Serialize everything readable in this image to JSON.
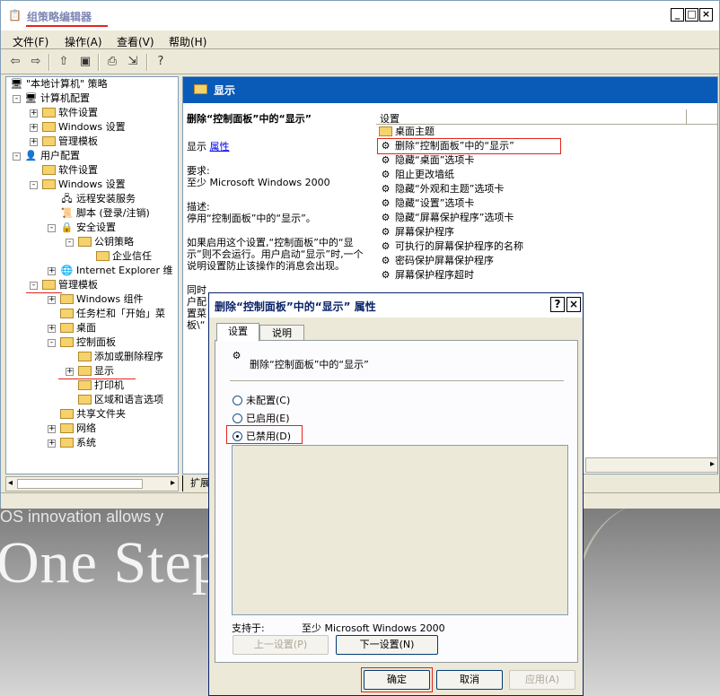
{
  "window": {
    "title": "组策略编辑器",
    "minimize": "_",
    "maximize": "□",
    "close": "×"
  },
  "menu": [
    "文件(F)",
    "操作(A)",
    "查看(V)",
    "帮助(H)"
  ],
  "toolbar": {
    "back": "⇦",
    "forward": "⇨",
    "up": "⇧",
    "show": "▣",
    "props": "⎙",
    "export": "⇲",
    "help": "?"
  },
  "tree": [
    {
      "label": "\"本地计算机\" 策略"
    },
    {
      "label": "计算机配置",
      "exp": "-"
    },
    {
      "label": "软件设置",
      "exp": "+"
    },
    {
      "label": "Windows 设置",
      "exp": "+"
    },
    {
      "label": "管理模板",
      "exp": "+"
    },
    {
      "label": "用户配置",
      "exp": "-"
    },
    {
      "label": "软件设置"
    },
    {
      "label": "Windows 设置",
      "exp": "-"
    },
    {
      "label": "远程安装服务"
    },
    {
      "label": "脚本 (登录/注销)"
    },
    {
      "label": "安全设置",
      "exp": "-"
    },
    {
      "label": "公钥策略",
      "exp": "-"
    },
    {
      "label": "企业信任"
    },
    {
      "label": "Internet Explorer 维",
      "exp": "+"
    },
    {
      "label": "管理模板",
      "exp": "-"
    },
    {
      "label": "Windows 组件",
      "exp": "+"
    },
    {
      "label": "任务栏和「开始」菜",
      "exp": ""
    },
    {
      "label": "桌面",
      "exp": "+"
    },
    {
      "label": "控制面板",
      "exp": "-"
    },
    {
      "label": "添加或删除程序"
    },
    {
      "label": "显示",
      "exp": "+"
    },
    {
      "label": "打印机"
    },
    {
      "label": "区域和语言选项"
    },
    {
      "label": "共享文件夹"
    },
    {
      "label": "网络",
      "exp": "+"
    },
    {
      "label": "系统",
      "exp": "+"
    }
  ],
  "content": {
    "header": "显示",
    "policy_title": "删除“控制面板”中的“显示”",
    "show_label": "显示",
    "props_link": "属性",
    "req_label": "要求:",
    "req_value": "至少 Microsoft Windows 2000",
    "desc_label": "描述:",
    "desc_text": "停用“控制面板”中的“显示”。",
    "desc_more": "如果启用这个设置,“控制面板”中的“显示”则不会运行。用户启动“显示”时,一个说明设置防止该操作的消息会出现。",
    "desc_extra": "同时\n户配\n置菜\n板\\“",
    "list_col": "设置",
    "items": [
      "桌面主题",
      "删除“控制面板”中的“显示”",
      "隐藏“桌面”选项卡",
      "阻止更改墙纸",
      "隐藏“外观和主题”选项卡",
      "隐藏“设置”选项卡",
      "隐藏“屏幕保护程序”选项卡",
      "屏幕保护程序",
      "可执行的屏幕保护程序的名称",
      "密码保护屏幕保护程序",
      "屏幕保护程序超时"
    ],
    "trunc": "元",
    "bottom_tab": "扩展"
  },
  "background": {
    "line1": "OS innovation allows y",
    "line2": "One Step"
  },
  "dialog": {
    "title": "删除“控制面板”中的“显示” 属性",
    "help": "?",
    "close": "×",
    "tab_settings": "设置",
    "tab_explain": "说明",
    "policy_name": "删除“控制面板”中的“显示”",
    "radio_nc": "未配置(C)",
    "radio_en": "已启用(E)",
    "radio_dis": "已禁用(D)",
    "selected": "已禁用(D)",
    "supported_label": "支持于:",
    "supported_value": "至少 Microsoft Windows 2000",
    "prev": "上一设置(P)",
    "next": "下一设置(N)",
    "ok": "确定",
    "cancel": "取消",
    "apply": "应用(A)"
  }
}
